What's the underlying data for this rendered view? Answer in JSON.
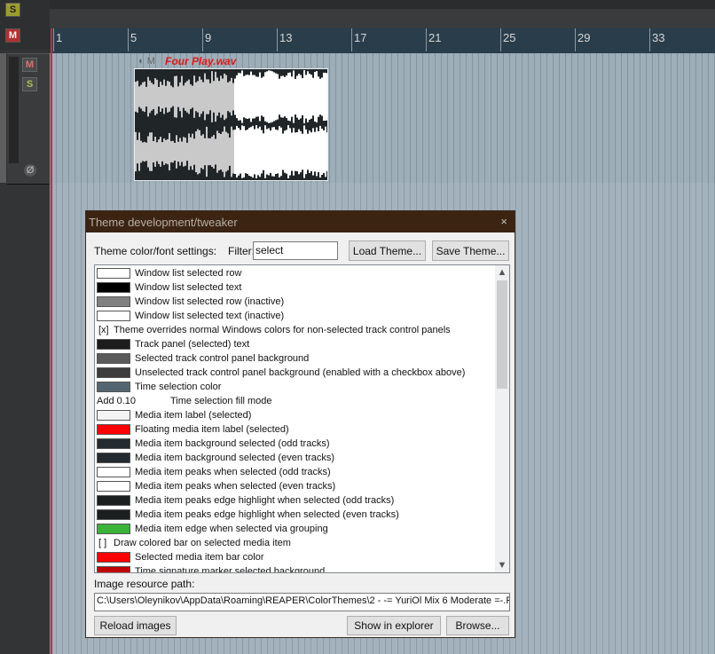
{
  "track_controls": {
    "master_solo": "S",
    "master_mute": "M",
    "track_mute": "M",
    "track_solo": "S",
    "env_icon": "Ø"
  },
  "ruler": {
    "labels": [
      "1",
      "5",
      "9",
      "13",
      "17",
      "21",
      "25",
      "29",
      "33"
    ]
  },
  "media_item": {
    "name": "Four Play.wav",
    "icons": "◐ M"
  },
  "dialog": {
    "title": "Theme development/tweaker",
    "close": "×",
    "settings_label": "Theme color/font settings:",
    "filter_label": "Filter:",
    "filter_value": "select",
    "load_theme": "Load Theme...",
    "save_theme": "Save Theme...",
    "image_path_label": "Image resource path:",
    "image_path_value": "C:\\Users\\Oleynikov\\AppData\\Roaming\\REAPER\\ColorThemes\\2 - -= YuriOl Mix 6  Moderate =-.F",
    "reload_images": "Reload images",
    "show_in_explorer": "Show in explorer",
    "browse": "Browse..."
  },
  "list_rows": [
    {
      "type": "color",
      "color": "#ffffff",
      "label": "Window list selected row"
    },
    {
      "type": "color",
      "color": "#000000",
      "label": "Window list selected text"
    },
    {
      "type": "color",
      "color": "#808080",
      "label": "Window list selected row (inactive)"
    },
    {
      "type": "color",
      "color": "#ffffff",
      "label": "Window list selected text (inactive)"
    },
    {
      "type": "check",
      "check": "[x]",
      "label": "Theme overrides normal Windows colors for non-selected track control panels"
    },
    {
      "type": "color",
      "color": "#1c1c1c",
      "label": "Track panel (selected) text"
    },
    {
      "type": "color",
      "color": "#5a5a5a",
      "label": "Selected track control panel background"
    },
    {
      "type": "color",
      "color": "#3c3c3c",
      "label": "Unselected track control panel background (enabled with a checkbox above)"
    },
    {
      "type": "color",
      "color": "#536570",
      "label": "Time selection color"
    },
    {
      "type": "mode",
      "value": "Add 0.10",
      "label": "Time selection fill mode"
    },
    {
      "type": "color",
      "color": "#f4f4f4",
      "label": "Media item label (selected)"
    },
    {
      "type": "color",
      "color": "#ff0000",
      "label": "Floating media item label (selected)"
    },
    {
      "type": "color",
      "color": "#232b30",
      "label": "Media item background selected (odd tracks)"
    },
    {
      "type": "color",
      "color": "#232b30",
      "label": "Media item background selected (even tracks)"
    },
    {
      "type": "color",
      "color": "#ffffff",
      "label": "Media item peaks when selected (odd tracks)"
    },
    {
      "type": "color",
      "color": "#ffffff",
      "label": "Media item peaks when selected (even tracks)"
    },
    {
      "type": "color",
      "color": "#1c1f20",
      "label": "Media item peaks edge highlight when selected (odd tracks)"
    },
    {
      "type": "color",
      "color": "#1c1f20",
      "label": "Media item peaks edge highlight when selected (even tracks)"
    },
    {
      "type": "color",
      "color": "#3ab33a",
      "label": "Media item edge when selected via grouping"
    },
    {
      "type": "check",
      "check": "[ ]",
      "label": "Draw colored bar on selected media item"
    },
    {
      "type": "color",
      "color": "#ff0000",
      "label": "Selected media item bar color"
    },
    {
      "type": "color",
      "color": "#c00000",
      "label": "Time signature marker selected background"
    }
  ],
  "scroll": {
    "up": "▲",
    "down": "▼"
  }
}
